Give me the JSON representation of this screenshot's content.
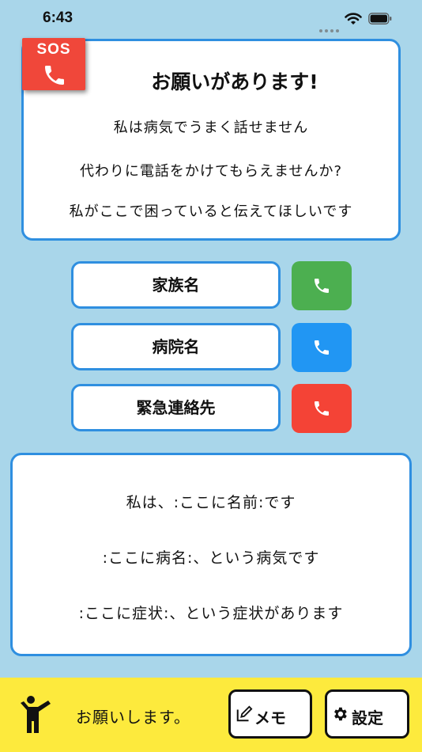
{
  "status_bar": {
    "time": "6:43"
  },
  "sos_badge": {
    "label": "SOS"
  },
  "request_card": {
    "title": "お願いがあります!",
    "lines": [
      "私は病気でうまく話せません",
      "代わりに電話をかけてもらえませんか?",
      "私がここで困っていると伝えてほしいです"
    ]
  },
  "contacts": [
    {
      "label": "家族名",
      "call_color": "#4caf50"
    },
    {
      "label": "病院名",
      "call_color": "#2196f3"
    },
    {
      "label": "緊急連絡先",
      "call_color": "#f44336"
    }
  ],
  "info_card": {
    "lines": [
      "私は、:ここに名前:です",
      ":ここに病名:、という病気です",
      ":ここに症状:、という症状があります"
    ]
  },
  "bottom_bar": {
    "message": "お願いします。",
    "memo_label": "メモ",
    "settings_label": "設定"
  },
  "colors": {
    "background": "#a9d6ea",
    "accent_border": "#2f8fe0",
    "sos_red": "#f0473a",
    "bottom_bar": "#fdea3d"
  }
}
